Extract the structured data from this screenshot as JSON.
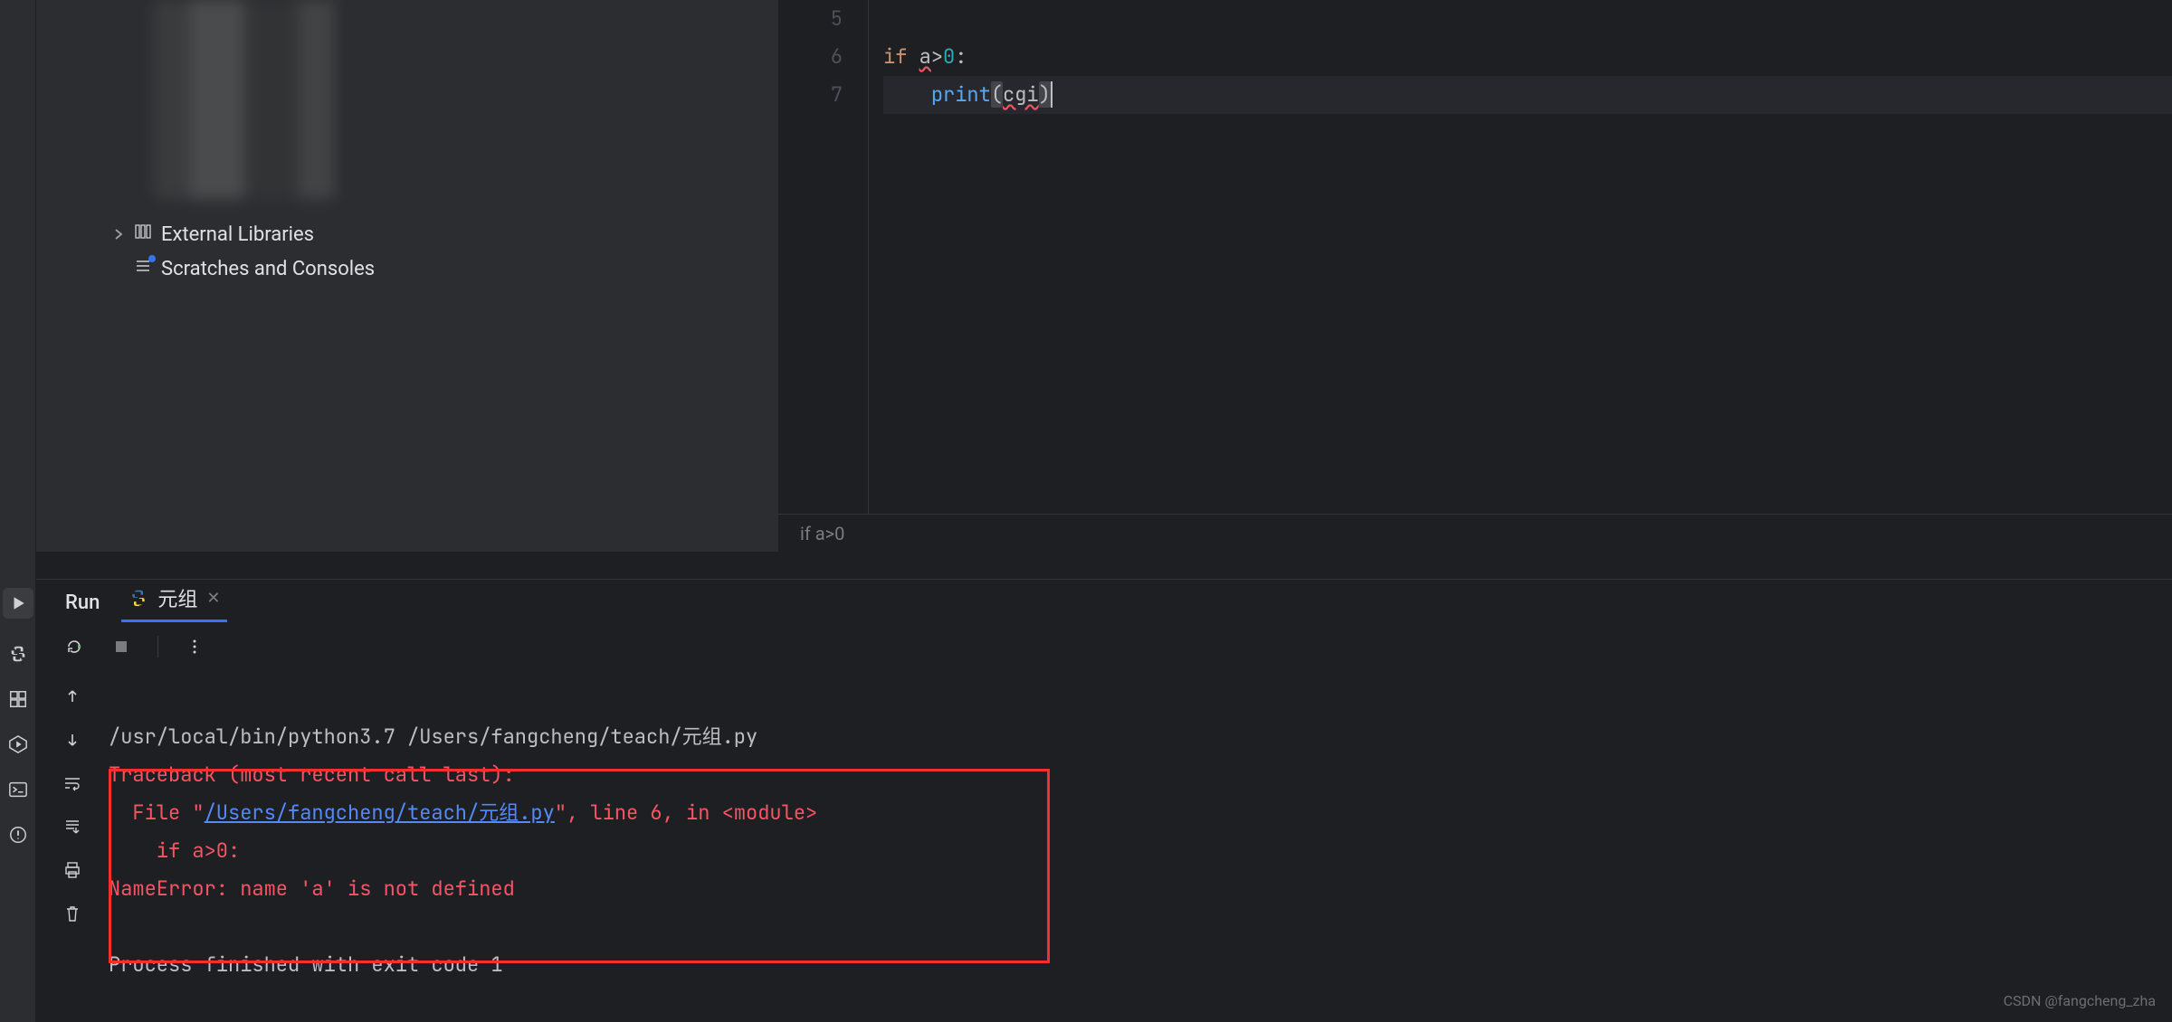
{
  "project_tree": {
    "external_libraries": "External Libraries",
    "scratches": "Scratches and Consoles"
  },
  "editor": {
    "line_numbers": [
      "5",
      "6",
      "7"
    ],
    "code": {
      "line6_if": "if",
      "line6_a": "a",
      "line6_gt": ">",
      "line6_zero": "0",
      "line6_colon": ":",
      "line7_indent": "    ",
      "line7_print": "print",
      "line7_lparen": "(",
      "line7_arg": "cgi",
      "line7_rparen": ")"
    },
    "breadcrumb": "if a>0"
  },
  "run_panel": {
    "title": "Run",
    "tab_name": "元组",
    "console": {
      "cmd": "/usr/local/bin/python3.7 /Users/fangcheng/teach/元组.py",
      "tb_header": "Traceback (most recent call last):",
      "tb_file_prefix": "  File \"",
      "tb_file_link": "/Users/fangcheng/teach/元组.py",
      "tb_file_suffix": "\", line 6, in <module>",
      "tb_code": "    if a>0:",
      "tb_error": "NameError: name 'a' is not defined",
      "exit": "Process finished with exit code 1"
    }
  },
  "watermark": "CSDN @fangcheng_zha"
}
